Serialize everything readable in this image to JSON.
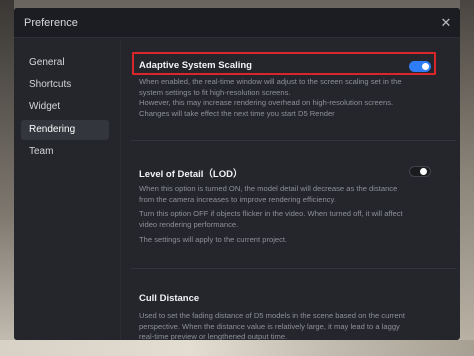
{
  "dialog": {
    "title": "Preference"
  },
  "sidebar": {
    "items": [
      {
        "label": "General",
        "active": false
      },
      {
        "label": "Shortcuts",
        "active": false
      },
      {
        "label": "Widget",
        "active": false
      },
      {
        "label": "Rendering",
        "active": true
      },
      {
        "label": "Team",
        "active": false
      }
    ]
  },
  "settings": {
    "adaptive": {
      "title": "Adaptive System Scaling",
      "enabled": true,
      "desc_lines": [
        "When enabled, the real-time window will adjust to the screen scaling set in the",
        "system settings to fit high-resolution screens.",
        "However, this may increase rendering overhead on high-resolution screens.",
        "Changes will take effect the next time you start D5 Render"
      ]
    },
    "lod": {
      "title": "Level of Detail（LOD）",
      "enabled": false,
      "desc1_lines": [
        "When this option is turned ON, the model detail will decrease as the distance",
        "from the camera increases to improve rendering efficiency."
      ],
      "desc2_lines": [
        "Turn this option OFF if objects flicker in the video. When turned off, it will affect",
        "video rendering performance."
      ],
      "desc3": "The settings will apply to the current project."
    },
    "cull": {
      "title": "Cull Distance",
      "desc_lines": [
        "Used to set the fading distance of D5 models in the scene based on the current",
        "perspective. When the distance value is relatively large, it may lead to a laggy",
        "real-time preview or lengthened output time."
      ]
    }
  }
}
